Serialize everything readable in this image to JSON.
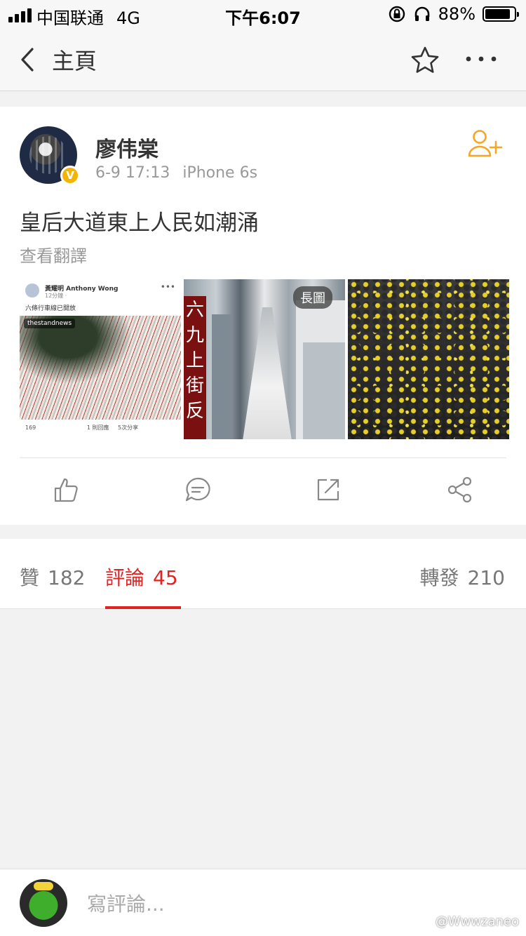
{
  "status_bar": {
    "carrier": "中国联通",
    "network": "4G",
    "time": "下午6:07",
    "battery_percent": "88%",
    "battery_level": 0.88
  },
  "nav": {
    "title": "主頁",
    "icons": [
      "chevron-left-icon",
      "star-icon",
      "more-icon"
    ]
  },
  "post": {
    "author": "廖伟棠",
    "verified_badge": "V",
    "date": "6-9 17:13",
    "device": "iPhone 6s",
    "text": "皇后大道東上人民如潮涌",
    "translate_label": "查看翻譯",
    "images": [
      {
        "name": "黃耀明 Anthony Wong",
        "ago": "12分鐘 · ",
        "caption": "六條行車線已開放",
        "tag": "thestandnews",
        "footer_reactions": "169",
        "footer_comments": "1 則回應",
        "footer_shares": "5次分享"
      },
      {
        "banner_text": "六九上街反",
        "badge": "長圖"
      },
      {}
    ],
    "actions": [
      "like-icon",
      "comment-icon",
      "repost-icon",
      "share-icon"
    ]
  },
  "tabs": [
    {
      "label": "贊",
      "count": "182"
    },
    {
      "label": "評論",
      "count": "45",
      "active": true
    },
    {
      "label": "轉發",
      "count": "210"
    }
  ],
  "comment_bar": {
    "placeholder": "寫評論...",
    "watermark": "@Wwwzaneo"
  },
  "colors": {
    "accent_red": "#e02424",
    "follow_orange": "#f5a623",
    "badge_yellow": "#f5b400"
  }
}
